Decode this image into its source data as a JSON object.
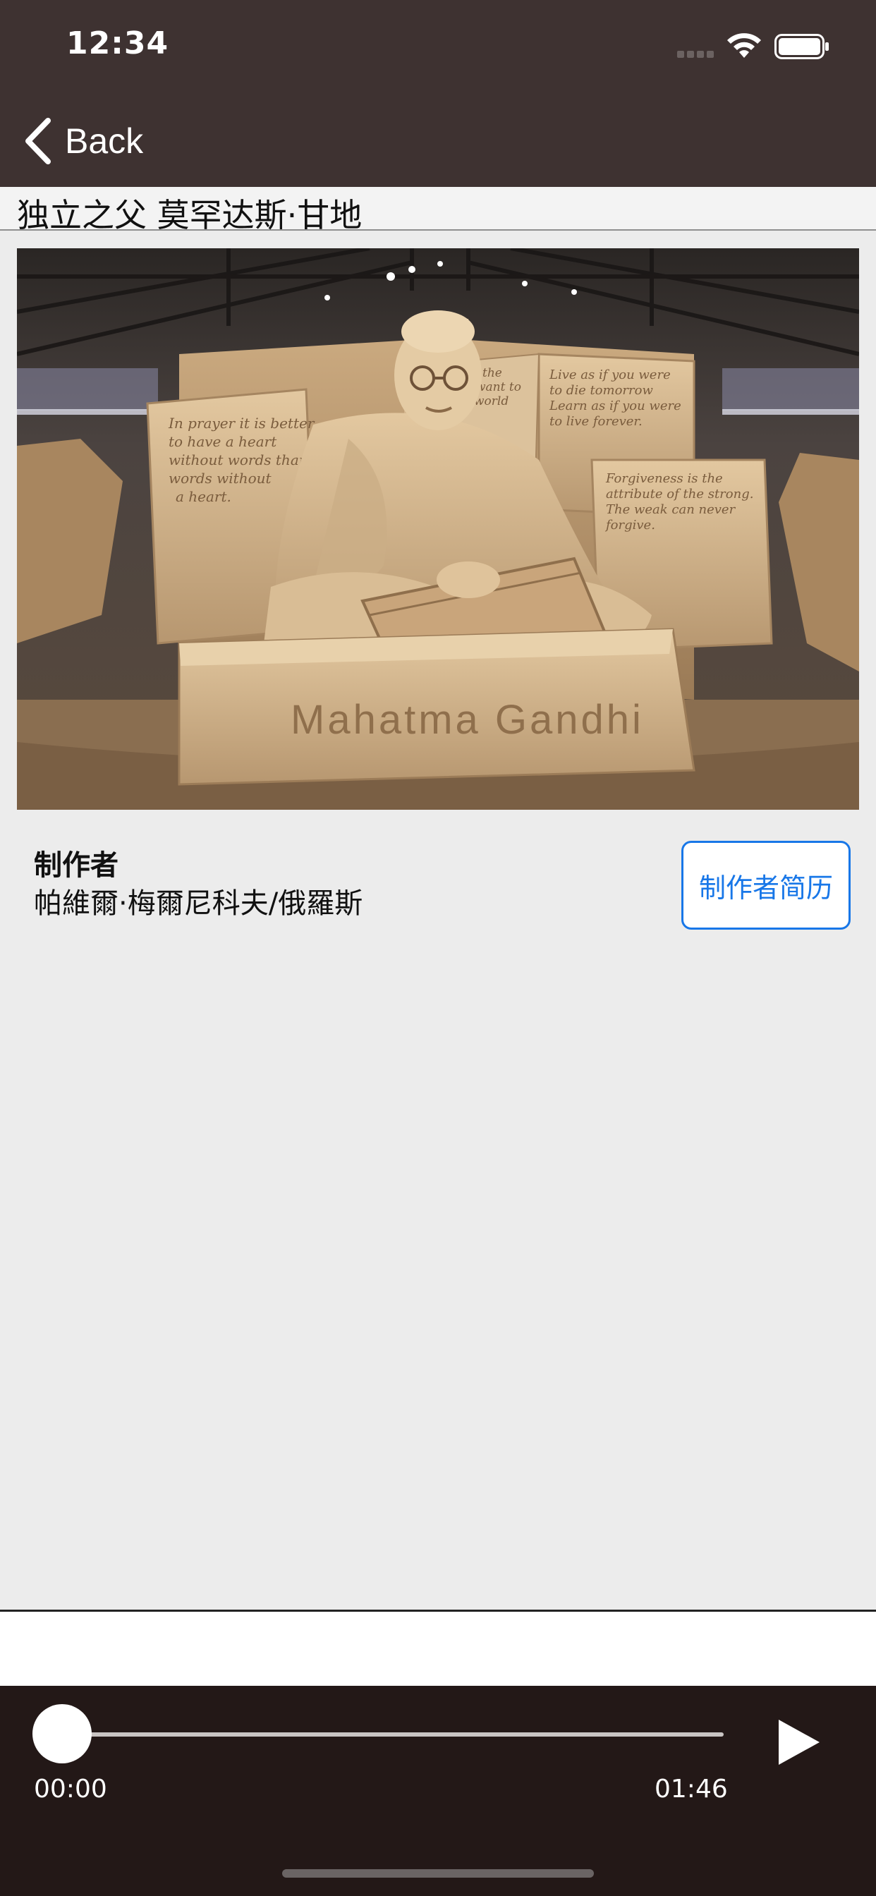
{
  "status_bar": {
    "time": "12:34"
  },
  "nav": {
    "back_label": "Back"
  },
  "page": {
    "title": "独立之父 莫罕达斯·甘地"
  },
  "artwork": {
    "inscription": "Mahatma Gandhi",
    "quote_left": [
      "In prayer it is better",
      "to have a heart",
      "without words than",
      "words without",
      "a heart."
    ],
    "quote_right_top": [
      "Live as if you were",
      "to die tomorrow",
      "Learn as if you were",
      "to live forever."
    ],
    "quote_right_bottom": [
      "Forgiveness is the",
      "attribute of the strong.",
      "The weak can never",
      "forgive."
    ],
    "quote_center_fragment": [
      "the",
      "want to",
      "world"
    ]
  },
  "creator": {
    "heading": "制作者",
    "name": "帕維爾·梅爾尼科夫/俄羅斯",
    "bio_button": "制作者简历"
  },
  "player": {
    "current_time": "00:00",
    "total_time": "01:46",
    "progress": 0
  }
}
